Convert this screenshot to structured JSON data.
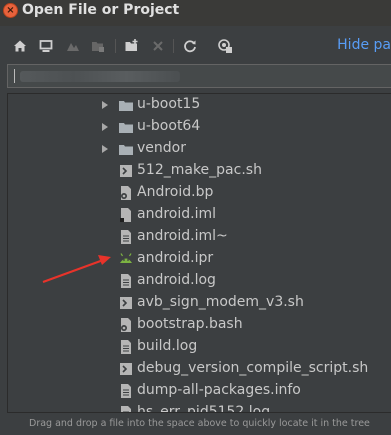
{
  "window": {
    "title": "Open File or Project",
    "close_glyph": "×"
  },
  "toolbar": {
    "hide_path_label": "Hide pa",
    "icons": [
      "home-icon",
      "desktop-icon",
      "project-icon",
      "module-icon",
      "new-folder-icon",
      "delete-icon",
      "refresh-icon",
      "show-hidden-icon"
    ]
  },
  "tree": {
    "items": [
      {
        "label": "u-boot15",
        "type": "folder",
        "expandable": true
      },
      {
        "label": "u-boot64",
        "type": "folder",
        "expandable": true
      },
      {
        "label": "vendor",
        "type": "folder",
        "expandable": true
      },
      {
        "label": "512_make_pac.sh",
        "type": "shell-script"
      },
      {
        "label": "Android.bp",
        "type": "config-file"
      },
      {
        "label": "android.iml",
        "type": "module-file"
      },
      {
        "label": "android.iml~",
        "type": "text-file"
      },
      {
        "label": "android.ipr",
        "type": "android-project"
      },
      {
        "label": "android.log",
        "type": "text-file"
      },
      {
        "label": "avb_sign_modem_v3.sh",
        "type": "shell-script"
      },
      {
        "label": "bootstrap.bash",
        "type": "config-file"
      },
      {
        "label": "build.log",
        "type": "text-file"
      },
      {
        "label": "debug_version_compile_script.sh",
        "type": "shell-script"
      },
      {
        "label": "dump-all-packages.info",
        "type": "text-file"
      },
      {
        "label": "hs_err_pid5152.log",
        "type": "text-file"
      }
    ]
  },
  "status": {
    "hint": "Drag and drop a file into the space above to quickly locate it in the tree"
  },
  "colors": {
    "background": "#3c3f41",
    "link": "#589df6",
    "annotation_arrow": "#e8332a",
    "android_green": "#7cb342"
  }
}
